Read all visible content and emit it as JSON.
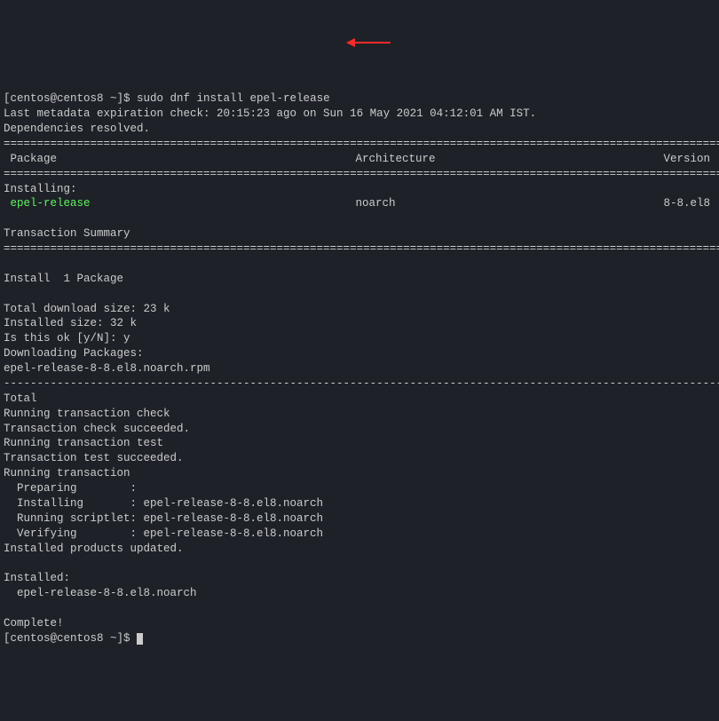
{
  "prompt1": "[centos@centos8 ~]$ ",
  "command": "sudo dnf install epel-release",
  "meta_line": "Last metadata expiration check: 20:15:23 ago on Sun 16 May 2021 04:12:01 AM IST.",
  "dep_line": "Dependencies resolved.",
  "divider_eq": "====================================================================================================================================",
  "divider_dash": "------------------------------------------------------------------------------------------------------------------------------------",
  "hdr_package": " Package",
  "hdr_arch": "Architecture",
  "hdr_version": "Version",
  "installing_label": "Installing:",
  "pkg_name": " epel-release",
  "pkg_arch": "noarch",
  "pkg_version": "8-8.el8",
  "txn_summary": "Transaction Summary",
  "install_count": "Install  1 Package",
  "dl_size": "Total download size: 23 k",
  "inst_size": "Installed size: 32 k",
  "confirm": "Is this ok [y/N]: y",
  "dl_pkgs": "Downloading Packages:",
  "rpm_file": "epel-release-8-8.el8.noarch.rpm",
  "total_label": "Total",
  "run_check": "Running transaction check",
  "check_ok": "Transaction check succeeded.",
  "run_test": "Running transaction test",
  "test_ok": "Transaction test succeeded.",
  "run_txn": "Running transaction",
  "preparing": "  Preparing        :",
  "installing": "  Installing       : epel-release-8-8.el8.noarch",
  "scriptlet": "  Running scriptlet: epel-release-8-8.el8.noarch",
  "verifying": "  Verifying        : epel-release-8-8.el8.noarch",
  "prod_updated": "Installed products updated.",
  "installed_label": "Installed:",
  "installed_pkg": "  epel-release-8-8.el8.noarch",
  "complete": "Complete!",
  "prompt2": "[centos@centos8 ~]$ "
}
